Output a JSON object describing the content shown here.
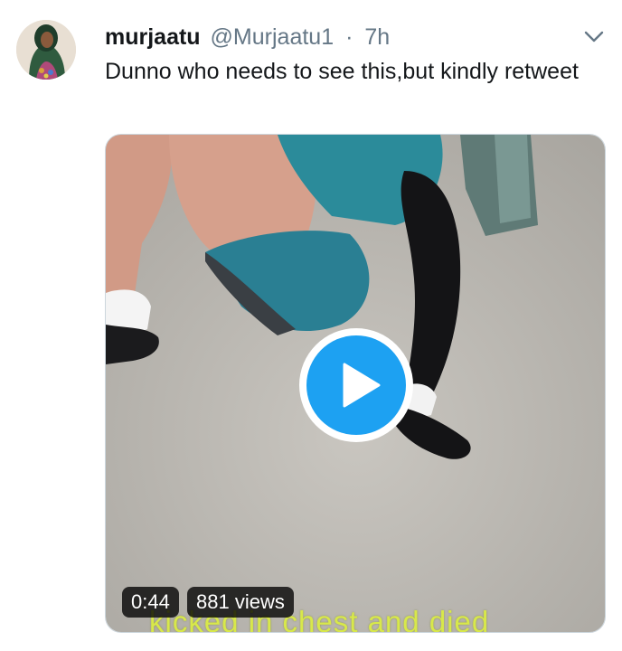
{
  "tweet": {
    "display_name": "murjaatu",
    "handle": "@Murjaatu1",
    "separator": "·",
    "time": "7h",
    "text": "Dunno who needs to see this,but kindly retweet",
    "menu_icon": "chevron-down-icon",
    "avatar_icon": "avatar"
  },
  "media": {
    "type": "video",
    "duration": "0:44",
    "views": "881 views",
    "caption_in_video": "kicked in chest and died",
    "play_icon": "play-icon"
  },
  "colors": {
    "accent": "#1da1f2",
    "text_primary": "#14171a",
    "text_secondary": "#657786",
    "caption": "#d8e84a"
  }
}
